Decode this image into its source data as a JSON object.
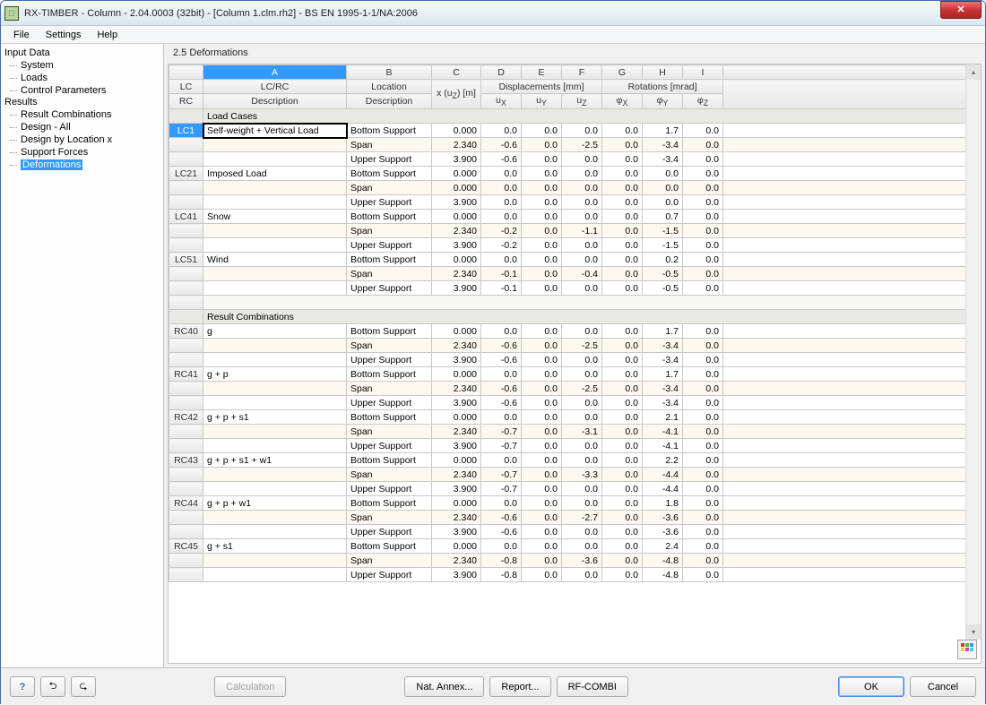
{
  "window": {
    "title": "RX-TIMBER - Column - 2.04.0003 (32bit) - [Column 1.clm.rh2] - BS EN 1995-1-1/NA:2006"
  },
  "menu": {
    "items": [
      "File",
      "Settings",
      "Help"
    ]
  },
  "tree": {
    "groups": [
      {
        "label": "Input Data",
        "items": [
          "System",
          "Loads",
          "Control Parameters"
        ]
      },
      {
        "label": "Results",
        "items": [
          "Result Combinations",
          "Design - All",
          "Design by Location x",
          "Support Forces",
          "Deformations"
        ]
      }
    ],
    "selected": "Deformations"
  },
  "content": {
    "heading": "2.5 Deformations",
    "col_letters": [
      "A",
      "B",
      "C",
      "D",
      "E",
      "F",
      "G",
      "H",
      "I"
    ],
    "header1": {
      "lcrc1": "LC",
      "lcrc2": "RC",
      "a": "LC/RC",
      "b": "Location",
      "disp": "Displacements [mm]",
      "rot": "Rotations [mrad]"
    },
    "header2": {
      "a": "Description",
      "b": "Description",
      "c": "x (u<sub>Z</sub>) [m]",
      "d": "u<sub>X</sub>",
      "e": "u<sub>Y</sub>",
      "f": "u<sub>Z</sub>",
      "g": "φ<sub>X</sub>",
      "h": "φ<sub>Y</sub>",
      "i": "φ<sub>Z</sub>"
    },
    "sections": [
      {
        "title": "Load Cases",
        "groups": [
          {
            "id": "LC1",
            "desc": "Self-weight + Vertical Load",
            "rows": [
              {
                "loc": "Bottom Support",
                "x": "0.000",
                "ux": "0.0",
                "uy": "0.0",
                "uz": "0.0",
                "px": "0.0",
                "py": "1.7",
                "pz": "0.0"
              },
              {
                "loc": "Span",
                "x": "2.340",
                "ux": "-0.6",
                "uy": "0.0",
                "uz": "-2.5",
                "px": "0.0",
                "py": "-3.4",
                "pz": "0.0"
              },
              {
                "loc": "Upper Support",
                "x": "3.900",
                "ux": "-0.6",
                "uy": "0.0",
                "uz": "0.0",
                "px": "0.0",
                "py": "-3.4",
                "pz": "0.0"
              }
            ]
          },
          {
            "id": "LC21",
            "desc": "Imposed Load",
            "rows": [
              {
                "loc": "Bottom Support",
                "x": "0.000",
                "ux": "0.0",
                "uy": "0.0",
                "uz": "0.0",
                "px": "0.0",
                "py": "0.0",
                "pz": "0.0"
              },
              {
                "loc": "Span",
                "x": "0.000",
                "ux": "0.0",
                "uy": "0.0",
                "uz": "0.0",
                "px": "0.0",
                "py": "0.0",
                "pz": "0.0"
              },
              {
                "loc": "Upper Support",
                "x": "3.900",
                "ux": "0.0",
                "uy": "0.0",
                "uz": "0.0",
                "px": "0.0",
                "py": "0.0",
                "pz": "0.0"
              }
            ]
          },
          {
            "id": "LC41",
            "desc": "Snow",
            "rows": [
              {
                "loc": "Bottom Support",
                "x": "0.000",
                "ux": "0.0",
                "uy": "0.0",
                "uz": "0.0",
                "px": "0.0",
                "py": "0.7",
                "pz": "0.0"
              },
              {
                "loc": "Span",
                "x": "2.340",
                "ux": "-0.2",
                "uy": "0.0",
                "uz": "-1.1",
                "px": "0.0",
                "py": "-1.5",
                "pz": "0.0"
              },
              {
                "loc": "Upper Support",
                "x": "3.900",
                "ux": "-0.2",
                "uy": "0.0",
                "uz": "0.0",
                "px": "0.0",
                "py": "-1.5",
                "pz": "0.0"
              }
            ]
          },
          {
            "id": "LC51",
            "desc": "Wind",
            "rows": [
              {
                "loc": "Bottom Support",
                "x": "0.000",
                "ux": "0.0",
                "uy": "0.0",
                "uz": "0.0",
                "px": "0.0",
                "py": "0.2",
                "pz": "0.0"
              },
              {
                "loc": "Span",
                "x": "2.340",
                "ux": "-0.1",
                "uy": "0.0",
                "uz": "-0.4",
                "px": "0.0",
                "py": "-0.5",
                "pz": "0.0"
              },
              {
                "loc": "Upper Support",
                "x": "3.900",
                "ux": "-0.1",
                "uy": "0.0",
                "uz": "0.0",
                "px": "0.0",
                "py": "-0.5",
                "pz": "0.0"
              }
            ]
          }
        ]
      },
      {
        "title": "Result Combinations",
        "groups": [
          {
            "id": "RC40",
            "desc": "g",
            "rows": [
              {
                "loc": "Bottom Support",
                "x": "0.000",
                "ux": "0.0",
                "uy": "0.0",
                "uz": "0.0",
                "px": "0.0",
                "py": "1.7",
                "pz": "0.0"
              },
              {
                "loc": "Span",
                "x": "2.340",
                "ux": "-0.6",
                "uy": "0.0",
                "uz": "-2.5",
                "px": "0.0",
                "py": "-3.4",
                "pz": "0.0"
              },
              {
                "loc": "Upper Support",
                "x": "3.900",
                "ux": "-0.6",
                "uy": "0.0",
                "uz": "0.0",
                "px": "0.0",
                "py": "-3.4",
                "pz": "0.0"
              }
            ]
          },
          {
            "id": "RC41",
            "desc": "g + p",
            "rows": [
              {
                "loc": "Bottom Support",
                "x": "0.000",
                "ux": "0.0",
                "uy": "0.0",
                "uz": "0.0",
                "px": "0.0",
                "py": "1.7",
                "pz": "0.0"
              },
              {
                "loc": "Span",
                "x": "2.340",
                "ux": "-0.6",
                "uy": "0.0",
                "uz": "-2.5",
                "px": "0.0",
                "py": "-3.4",
                "pz": "0.0"
              },
              {
                "loc": "Upper Support",
                "x": "3.900",
                "ux": "-0.6",
                "uy": "0.0",
                "uz": "0.0",
                "px": "0.0",
                "py": "-3.4",
                "pz": "0.0"
              }
            ]
          },
          {
            "id": "RC42",
            "desc": "g + p + s1",
            "rows": [
              {
                "loc": "Bottom Support",
                "x": "0.000",
                "ux": "0.0",
                "uy": "0.0",
                "uz": "0.0",
                "px": "0.0",
                "py": "2.1",
                "pz": "0.0"
              },
              {
                "loc": "Span",
                "x": "2.340",
                "ux": "-0.7",
                "uy": "0.0",
                "uz": "-3.1",
                "px": "0.0",
                "py": "-4.1",
                "pz": "0.0"
              },
              {
                "loc": "Upper Support",
                "x": "3.900",
                "ux": "-0.7",
                "uy": "0.0",
                "uz": "0.0",
                "px": "0.0",
                "py": "-4.1",
                "pz": "0.0"
              }
            ]
          },
          {
            "id": "RC43",
            "desc": "g + p + s1 + w1",
            "rows": [
              {
                "loc": "Bottom Support",
                "x": "0.000",
                "ux": "0.0",
                "uy": "0.0",
                "uz": "0.0",
                "px": "0.0",
                "py": "2.2",
                "pz": "0.0"
              },
              {
                "loc": "Span",
                "x": "2.340",
                "ux": "-0.7",
                "uy": "0.0",
                "uz": "-3.3",
                "px": "0.0",
                "py": "-4.4",
                "pz": "0.0"
              },
              {
                "loc": "Upper Support",
                "x": "3.900",
                "ux": "-0.7",
                "uy": "0.0",
                "uz": "0.0",
                "px": "0.0",
                "py": "-4.4",
                "pz": "0.0"
              }
            ]
          },
          {
            "id": "RC44",
            "desc": "g + p + w1",
            "rows": [
              {
                "loc": "Bottom Support",
                "x": "0.000",
                "ux": "0.0",
                "uy": "0.0",
                "uz": "0.0",
                "px": "0.0",
                "py": "1.8",
                "pz": "0.0"
              },
              {
                "loc": "Span",
                "x": "2.340",
                "ux": "-0.6",
                "uy": "0.0",
                "uz": "-2.7",
                "px": "0.0",
                "py": "-3.6",
                "pz": "0.0"
              },
              {
                "loc": "Upper Support",
                "x": "3.900",
                "ux": "-0.6",
                "uy": "0.0",
                "uz": "0.0",
                "px": "0.0",
                "py": "-3.6",
                "pz": "0.0"
              }
            ]
          },
          {
            "id": "RC45",
            "desc": "g + s1",
            "rows": [
              {
                "loc": "Bottom Support",
                "x": "0.000",
                "ux": "0.0",
                "uy": "0.0",
                "uz": "0.0",
                "px": "0.0",
                "py": "2.4",
                "pz": "0.0"
              },
              {
                "loc": "Span",
                "x": "2.340",
                "ux": "-0.8",
                "uy": "0.0",
                "uz": "-3.6",
                "px": "0.0",
                "py": "-4.8",
                "pz": "0.0"
              },
              {
                "loc": "Upper Support",
                "x": "3.900",
                "ux": "-0.8",
                "uy": "0.0",
                "uz": "0.0",
                "px": "0.0",
                "py": "-4.8",
                "pz": "0.0"
              }
            ]
          }
        ]
      }
    ]
  },
  "footer": {
    "calculation": "Calculation",
    "nat_annex": "Nat. Annex...",
    "report": "Report...",
    "rfcombi": "RF-COMBI",
    "ok": "OK",
    "cancel": "Cancel"
  }
}
